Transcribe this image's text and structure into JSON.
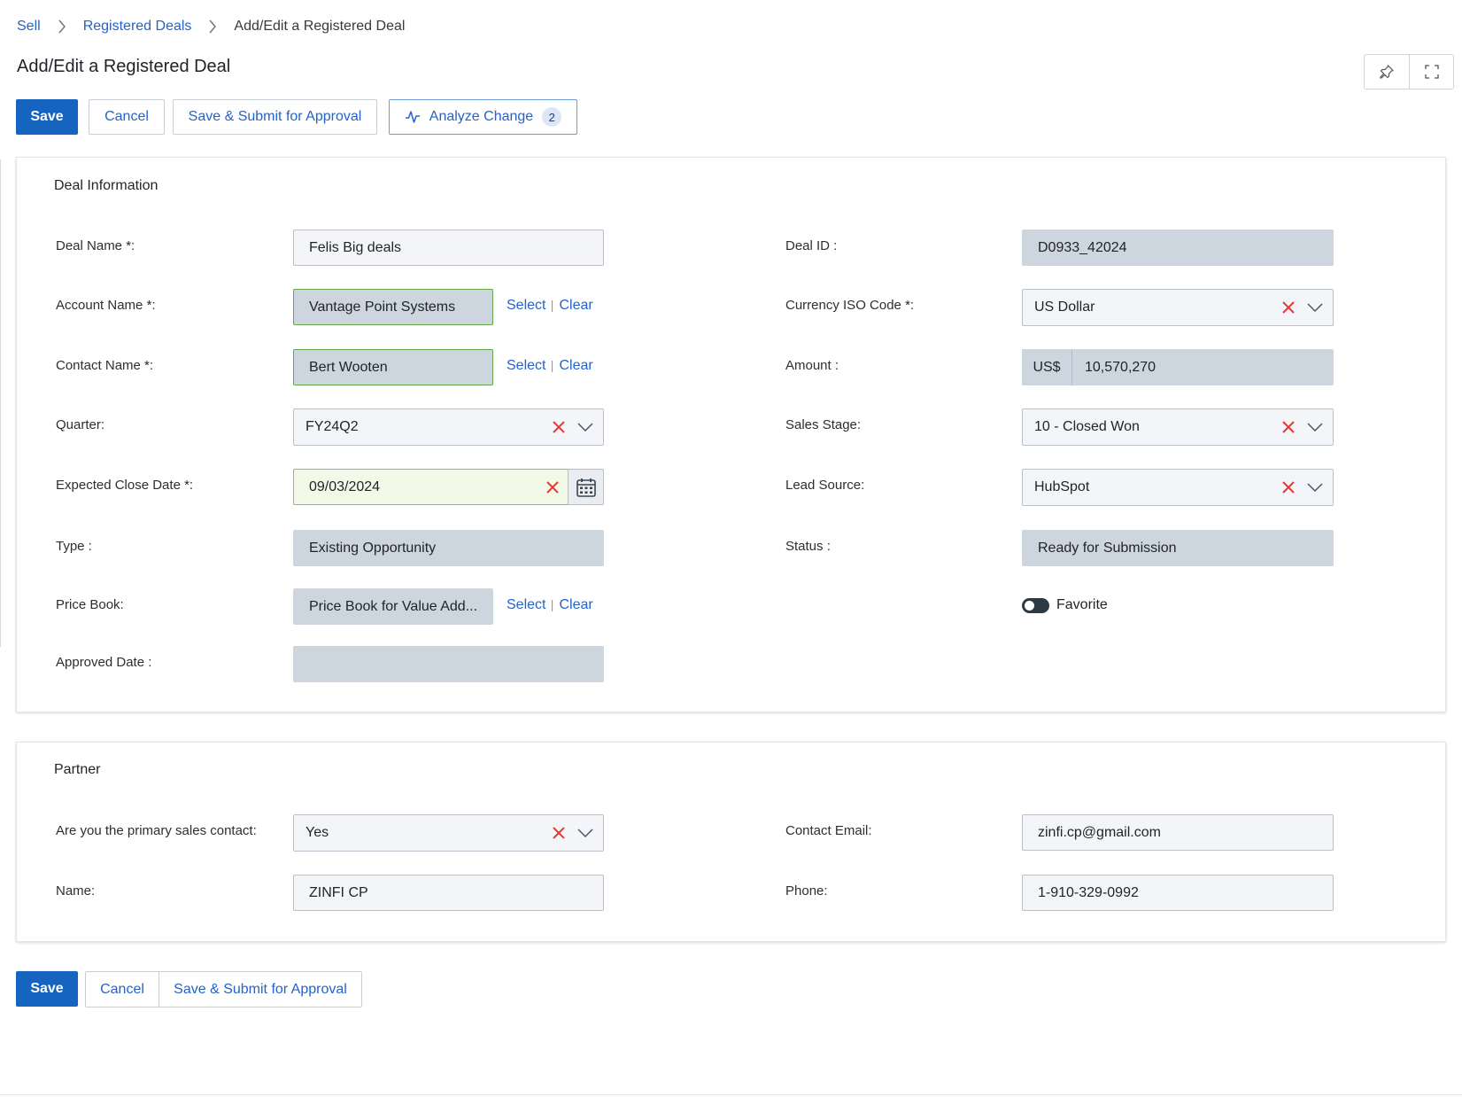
{
  "breadcrumb": {
    "items": [
      "Sell",
      "Registered Deals"
    ],
    "current": "Add/Edit a Registered Deal"
  },
  "page": {
    "title": "Add/Edit a Registered Deal"
  },
  "toolbar": {
    "save": "Save",
    "cancel": "Cancel",
    "save_submit": "Save & Submit for Approval",
    "analyze": "Analyze Change",
    "analyze_count": "2",
    "icons": [
      "pin-icon",
      "fullscreen-icon"
    ]
  },
  "deal_info": {
    "title": "Deal Information",
    "deal_name": {
      "label": "Deal Name",
      "req": "*",
      "suffix": ":",
      "value": "Felis Big deals"
    },
    "account_name": {
      "label": "Account Name",
      "req": "*",
      "suffix": ":",
      "value": "Vantage Point Systems"
    },
    "contact_name": {
      "label": "Contact Name",
      "req": "*",
      "suffix": ":",
      "value": "Bert Wooten"
    },
    "quarter": {
      "label": "Quarter:",
      "value": "FY24Q2"
    },
    "expected_close": {
      "label": "Expected Close Date ",
      "req": "*",
      "suffix": ":",
      "value": "09/03/2024"
    },
    "type": {
      "label": "Type :",
      "value": "Existing Opportunity"
    },
    "price_book": {
      "label": "Price Book:",
      "value": "Price Book for Value Add..."
    },
    "approved_date": {
      "label": "Approved Date :",
      "value": ""
    },
    "deal_id": {
      "label": "Deal ID :",
      "value": "D0933_42024"
    },
    "currency": {
      "label": "Currency ISO Code",
      "req": "*",
      "suffix": ":",
      "value": "US Dollar"
    },
    "amount": {
      "label": "Amount :",
      "prefix": "US$",
      "value": "10,570,270"
    },
    "sales_stage": {
      "label": "Sales Stage:",
      "value": "10 - Closed Won"
    },
    "lead_source": {
      "label": "Lead Source:",
      "value": "HubSpot"
    },
    "status": {
      "label": "Status :",
      "value": "Ready for Submission"
    },
    "favorite": {
      "label": "Favorite"
    },
    "select_link": "Select",
    "clear_link": "Clear"
  },
  "partner": {
    "title": "Partner",
    "primary_contact": {
      "label": "Are you the primary sales contact:",
      "value": "Yes"
    },
    "name": {
      "label": "Name:",
      "value": "ZINFI CP"
    },
    "contact_email": {
      "label": "Contact Email:",
      "value": "zinfi.cp@gmail.com"
    },
    "phone": {
      "label": "Phone:",
      "value": "1-910-329-0992"
    }
  },
  "colors": {
    "primary": "#1565c0",
    "link": "#2563c9",
    "clear_x": "#e53935",
    "readonly_bg": "#cdd5df",
    "valid_border": "#62a84a"
  }
}
